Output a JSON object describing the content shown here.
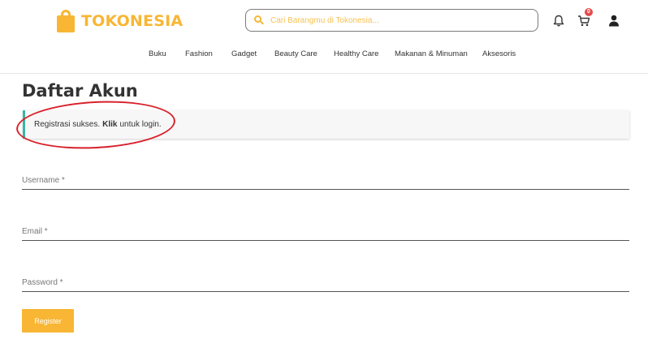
{
  "brand": {
    "name": "TOKONESIA",
    "color": "#F8B634"
  },
  "search": {
    "placeholder": "Cari Barangmu di Tokonesia..."
  },
  "header": {
    "cart_count": "0",
    "icons": [
      "bell-icon",
      "cart-icon",
      "user-icon"
    ]
  },
  "nav": {
    "items": [
      "Buku",
      "Fashion",
      "Gadget",
      "Beauty Care",
      "Healthy Care",
      "Makanan & Minuman",
      "Aksesoris"
    ]
  },
  "main": {
    "title": "Daftar Akun",
    "notice": {
      "prefix": "Registrasi sukses.",
      "link": "Klik",
      "suffix": "untuk login.",
      "accent_color": "#3ab5a5"
    },
    "fields": {
      "username_placeholder": "Username *",
      "email_placeholder": "Email *",
      "password_placeholder": "Password *"
    },
    "register_label": "Register"
  }
}
